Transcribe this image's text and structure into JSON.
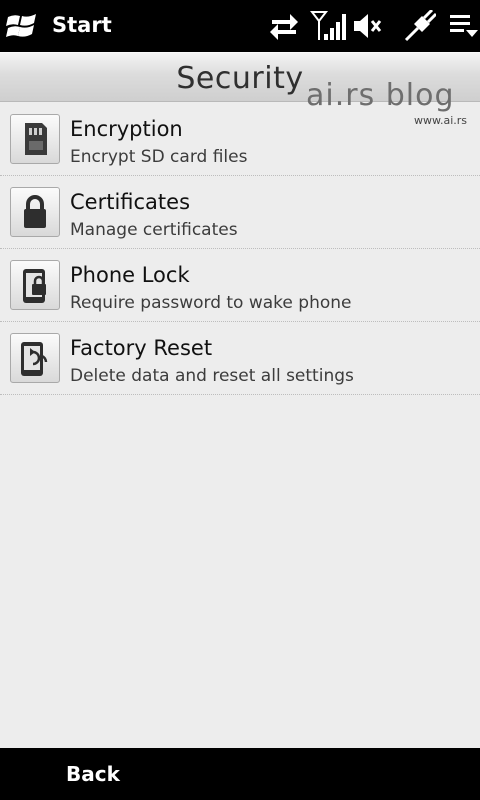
{
  "status_bar": {
    "start_label": "Start",
    "icons": [
      "windows-logo-icon",
      "data-sync-icon",
      "signal-strength-icon",
      "volume-muted-icon",
      "usb-connection-icon",
      "menu-icon"
    ]
  },
  "header": {
    "title": "Security"
  },
  "watermark": {
    "text": "ai.rs blog",
    "url": "www.ai.rs"
  },
  "items": [
    {
      "title": "Encryption",
      "subtitle": "Encrypt SD card files",
      "icon": "sd-card-icon"
    },
    {
      "title": "Certificates",
      "subtitle": "Manage certificates",
      "icon": "padlock-icon"
    },
    {
      "title": "Phone Lock",
      "subtitle": "Require password to wake phone",
      "icon": "phone-lock-icon"
    },
    {
      "title": "Factory Reset",
      "subtitle": "Delete data and reset all settings",
      "icon": "phone-reset-icon"
    }
  ],
  "softkeys": {
    "back_label": "Back"
  },
  "colors": {
    "bars": "#000000",
    "background": "#ededed",
    "title_text": "#2f2f2f"
  }
}
